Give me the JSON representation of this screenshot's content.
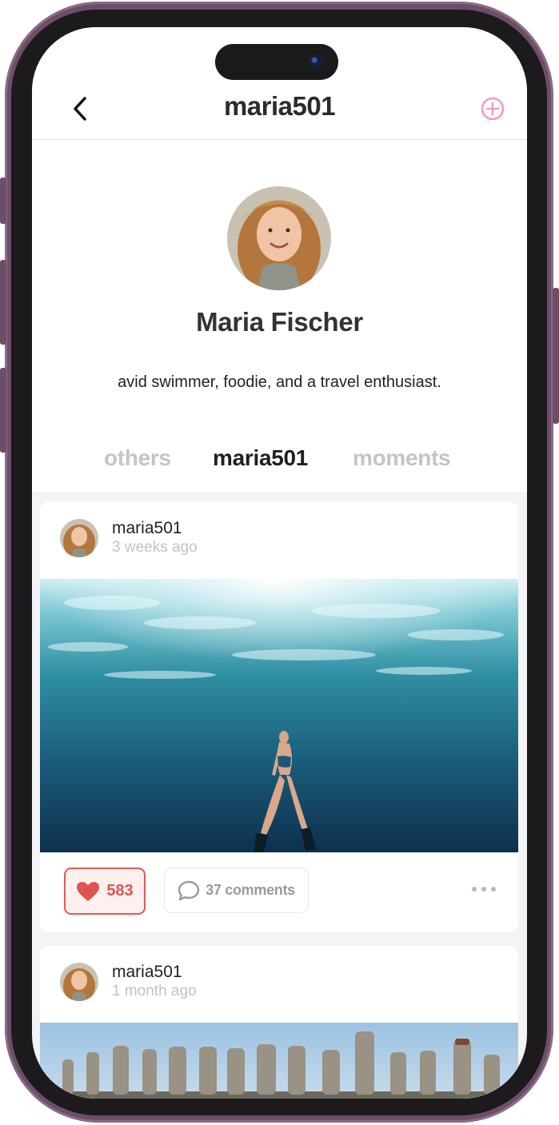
{
  "header": {
    "title": "maria501",
    "back_icon": "chevron-left-icon",
    "add_icon": "plus-circle-icon",
    "accent_color": "#f29bc0"
  },
  "profile": {
    "name": "Maria Fischer",
    "bio": "avid swimmer, foodie, and a travel enthusiast."
  },
  "tabs": [
    {
      "label": "others",
      "active": false
    },
    {
      "label": "maria501",
      "active": true
    },
    {
      "label": "moments",
      "active": false
    }
  ],
  "posts": [
    {
      "username": "maria501",
      "time": "3 weeks ago",
      "likes": "583",
      "comments": "37 comments",
      "like_icon": "heart-icon",
      "comment_icon": "speech-bubble-icon",
      "more_icon": "more-dots-icon"
    },
    {
      "username": "maria501",
      "time": "1 month ago"
    }
  ],
  "colors": {
    "like": "#e05450",
    "like_bg": "#fdf0ef",
    "muted": "#c4c4c6",
    "text": "#2b2b2b"
  }
}
